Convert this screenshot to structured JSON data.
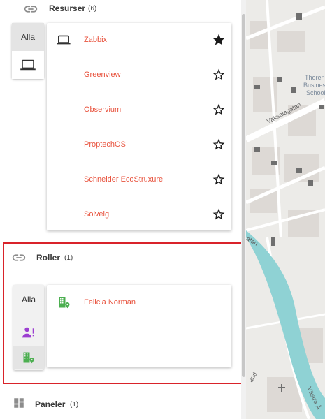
{
  "sections": {
    "resurser": {
      "title": "Resurser",
      "count": "(6)"
    },
    "roller": {
      "title": "Roller",
      "count": "(1)"
    },
    "paneler": {
      "title": "Paneler",
      "count": "(1)"
    }
  },
  "resurser_filter": {
    "all_label": "Alla"
  },
  "resources": [
    {
      "name": "Zabbix",
      "icon": "laptop-icon",
      "favorite": true
    },
    {
      "name": "Greenview",
      "favorite": false
    },
    {
      "name": "Observium",
      "favorite": false
    },
    {
      "name": "ProptechOS",
      "favorite": false
    },
    {
      "name": "Schneider EcoStruxure",
      "favorite": false
    },
    {
      "name": "Solveig",
      "favorite": false
    }
  ],
  "roller_filter": {
    "all_label": "Alla"
  },
  "roles": [
    {
      "name": "Felicia Norman",
      "icon": "building-pin-icon"
    }
  ],
  "map": {
    "labels": [
      "Thoren",
      "Busines",
      "School"
    ],
    "streets": [
      "Vaksalagatan",
      "atan",
      "and",
      "Västra Å"
    ]
  },
  "colors": {
    "link": "#e8523d",
    "highlight_border": "#d9232a",
    "role_person_icon": "#9c3fd1",
    "building_icon": "#4caf50",
    "river": "#8fd2d4"
  }
}
